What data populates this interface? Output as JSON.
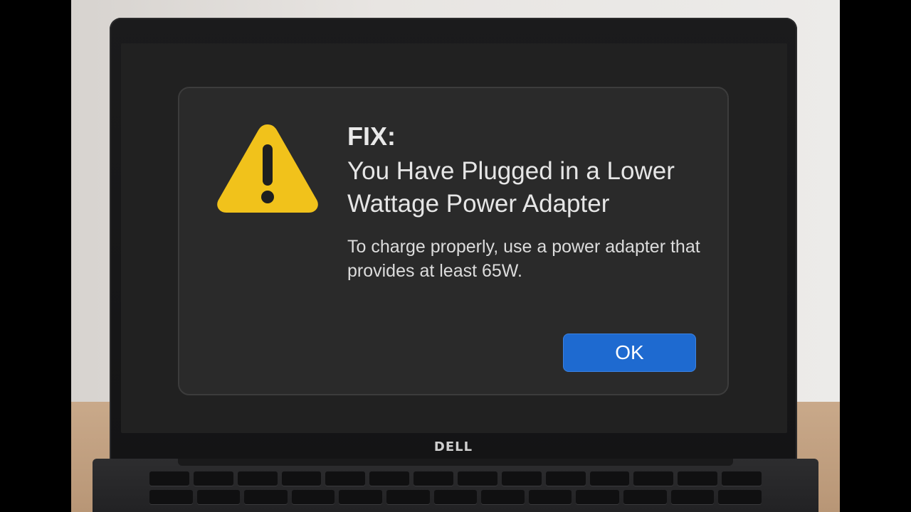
{
  "device": {
    "brand_logo": "DELL"
  },
  "dialog": {
    "icon": "warning-triangle-icon",
    "fix_label": "FIX:",
    "title": "You Have Plugged in a Lower Wattage Power Adapter",
    "body": "To charge properly, use a power adapter that provides at least 65W.",
    "ok_label": "OK"
  },
  "colors": {
    "warning_yellow": "#f1c21b",
    "button_blue": "#1e6ad0",
    "dialog_background": "#2a2a2a",
    "screen_background": "#212121"
  }
}
